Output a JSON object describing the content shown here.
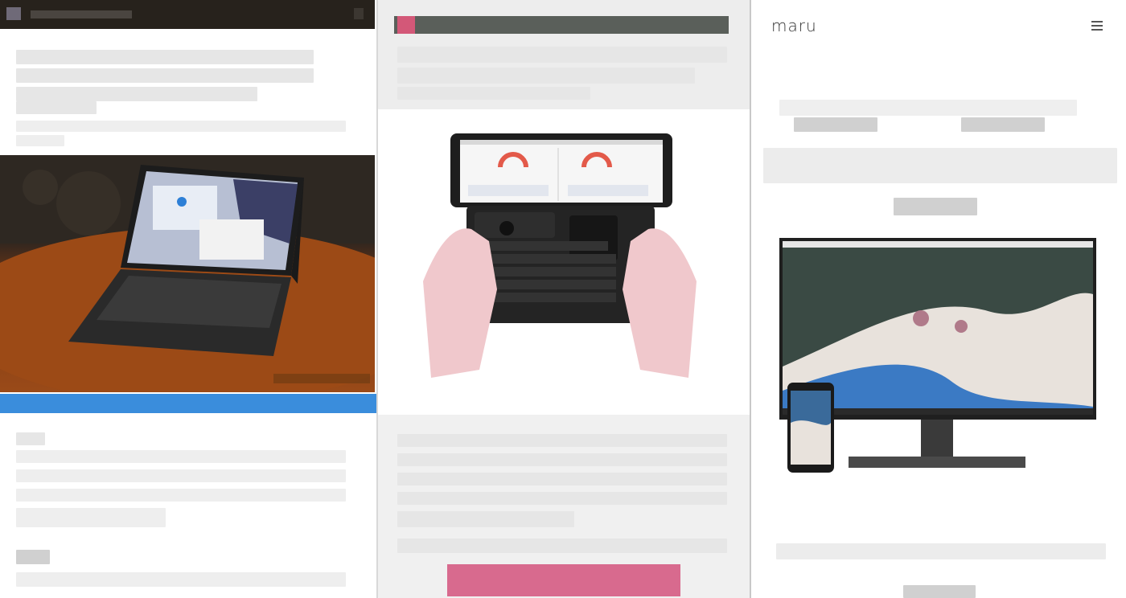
{
  "right_panel": {
    "brand": "maru",
    "menu_icon": "hamburger-menu-icon"
  },
  "colors": {
    "left_header": "#27221c",
    "left_accent_bar": "#3a8ddc",
    "middle_accent": "#d35878",
    "middle_cta": "#d86a8e"
  },
  "images": {
    "left": "tablet-with-keyboard-photo",
    "middle": "handheld-pc-photo",
    "right": "monitor-and-phone-photo"
  }
}
